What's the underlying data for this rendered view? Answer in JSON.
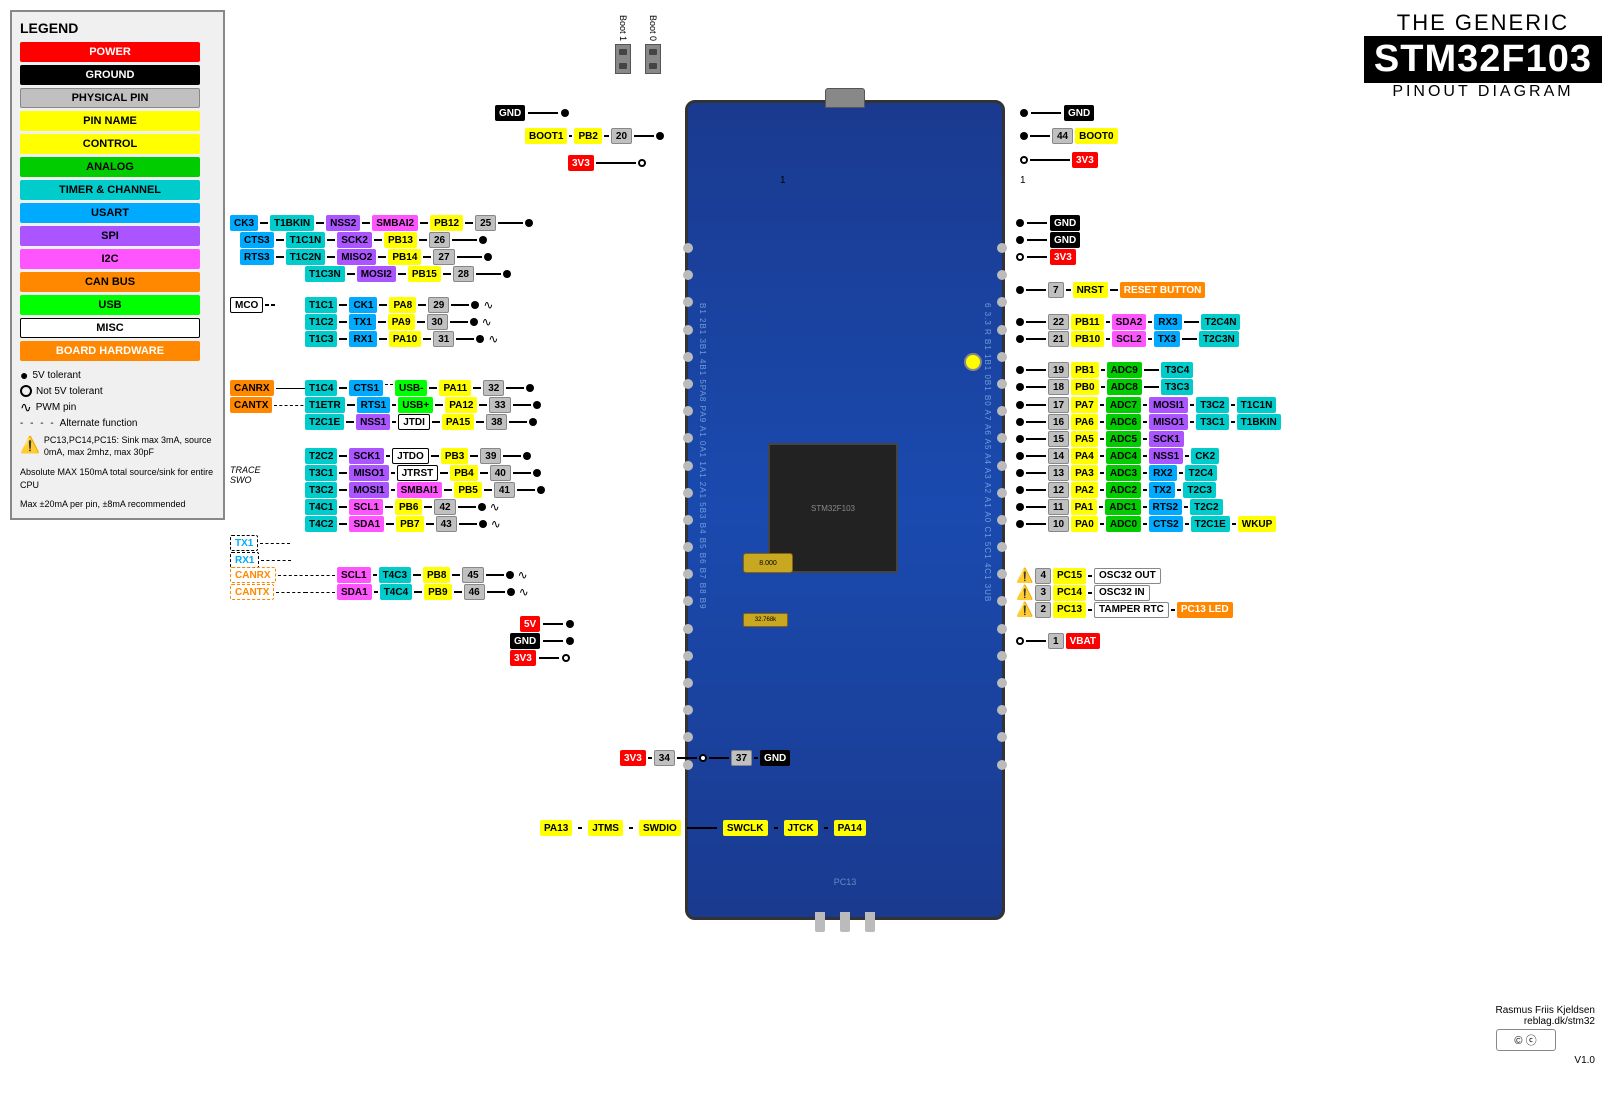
{
  "title": {
    "line1": "THE GENERIC",
    "line2": "STM32F103",
    "line3": "PINOUT DIAGRAM"
  },
  "legend": {
    "heading": "LEGEND",
    "items": [
      {
        "label": "POWER",
        "class": "power-pin"
      },
      {
        "label": "GROUND",
        "class": "ground-pin"
      },
      {
        "label": "PHYSICAL PIN",
        "class": "physical-pin"
      },
      {
        "label": "PIN NAME",
        "class": "pin-name"
      },
      {
        "label": "CONTROL",
        "class": "control-pin"
      },
      {
        "label": "ANALOG",
        "class": "analog-pin"
      },
      {
        "label": "TIMER & CHANNEL",
        "class": "timer-pin"
      },
      {
        "label": "USART",
        "class": "usart-pin"
      },
      {
        "label": "SPI",
        "class": "spi-pin"
      },
      {
        "label": "I2C",
        "class": "i2c-pin"
      },
      {
        "label": "CAN BUS",
        "class": "can-pin"
      },
      {
        "label": "USB",
        "class": "usb-pin"
      },
      {
        "label": "MISC",
        "class": "misc-pin"
      },
      {
        "label": "BOARD HARDWARE",
        "class": "board-hw"
      }
    ],
    "symbols": [
      {
        "sym": "●",
        "text": "5V tolerant"
      },
      {
        "sym": "○",
        "text": "Not 5V tolerant"
      },
      {
        "sym": "∿",
        "text": "PWM pin"
      },
      {
        "sym": "- - - -",
        "text": "Alternate function"
      }
    ],
    "warning": "PC13,PC14,PC15: Sink max 3mA, source 0mA, max 2mhz, max 30pF",
    "note1": "Absolute MAX 150mA total source/sink for entire CPU",
    "note2": "Max ±20mA per pin, ±8mA recommended"
  },
  "credit": {
    "author": "Rasmus Friis Kjeldsen",
    "site": "reblag.dk/stm32",
    "version": "V1.0"
  }
}
